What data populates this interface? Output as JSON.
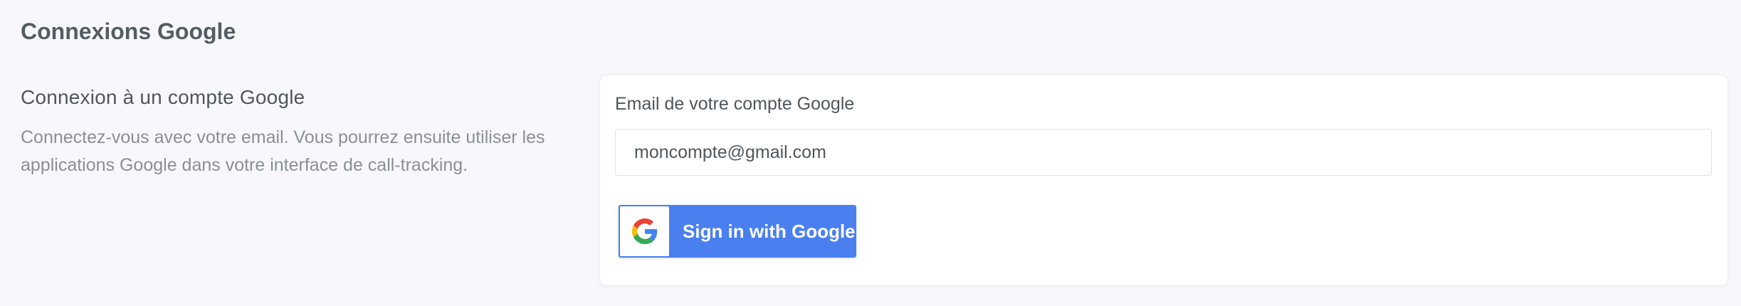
{
  "header": {
    "title": "Connexions Google"
  },
  "section": {
    "heading": "Connexion à un compte Google",
    "description": "Connectez-vous avec votre email. Vous pourrez ensuite utiliser les applications Google dans votre interface de call-tracking."
  },
  "form": {
    "email_label": "Email de votre compte Google",
    "email_value": "moncompte@gmail.com",
    "signin_button_label": "Sign in with Google"
  },
  "icons": {
    "google_logo": "google-g-icon"
  },
  "colors": {
    "background": "#f8f8fc",
    "google_button": "#4a7ff0",
    "google_red": "#EA4335",
    "google_blue": "#4285F4",
    "google_yellow": "#FBBC05",
    "google_green": "#34A853"
  }
}
